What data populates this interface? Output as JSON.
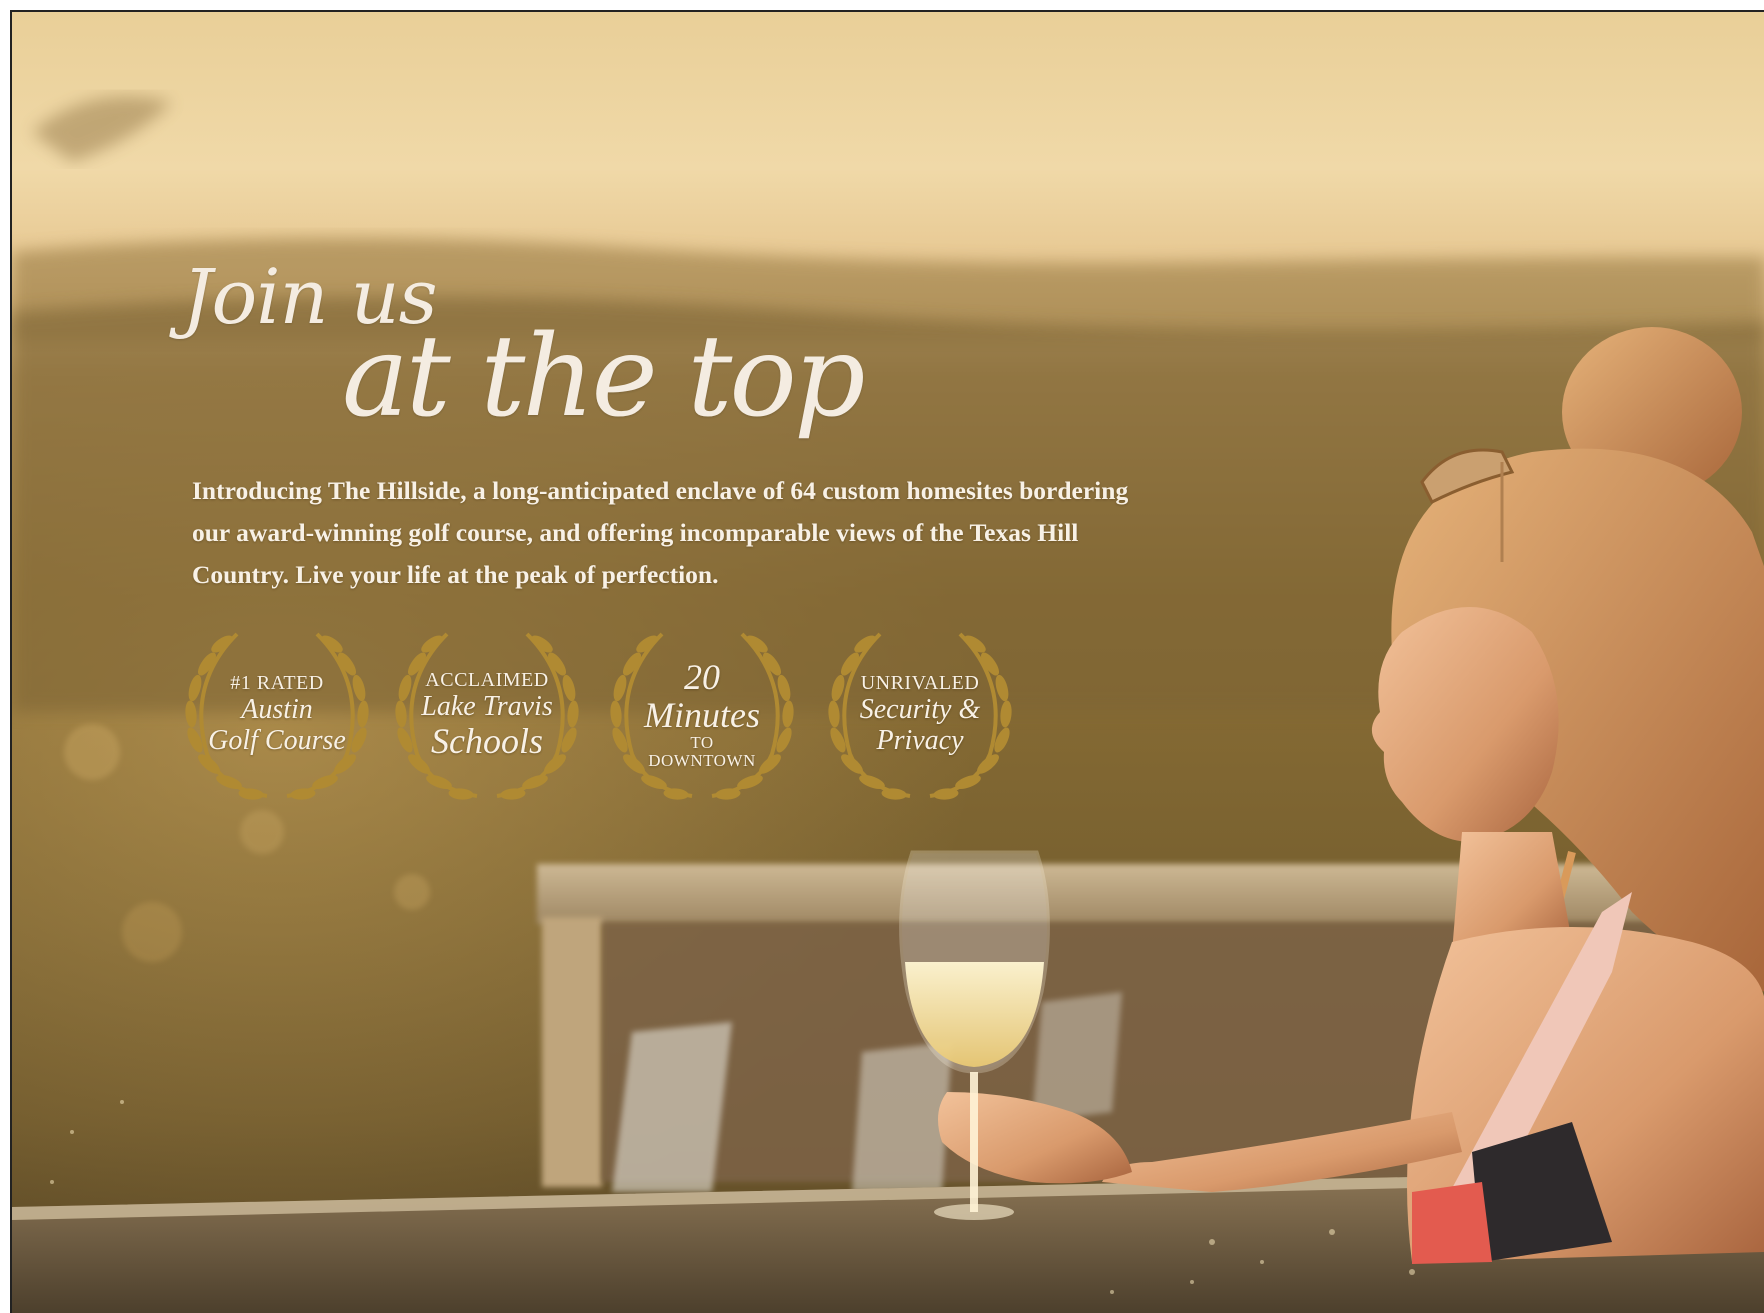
{
  "headline": {
    "line1": "Join us",
    "line2": "at the top"
  },
  "intro": "Introducing The Hillside, a long-anticipated enclave of 64 custom homesites bordering our award-winning golf course, and offering incomparable views of the Texas Hill Country. Live your life at the peak of perfection.",
  "badges": [
    {
      "caption": "#1 RATED",
      "line1": "Austin",
      "line2": "Golf Course"
    },
    {
      "caption": "ACCLAIMED",
      "line1": "Lake Travis",
      "line2": "Schools"
    },
    {
      "big": "20",
      "line1": "Minutes",
      "small1": "TO",
      "small2": "DOWNTOWN"
    },
    {
      "caption": "UNRIVALED",
      "line1": "Security &",
      "line2": "Privacy"
    }
  ],
  "colors": {
    "laurel_gold": "#b08a32",
    "text_cream": "#f4ece1",
    "sky": "#eedbb0"
  }
}
